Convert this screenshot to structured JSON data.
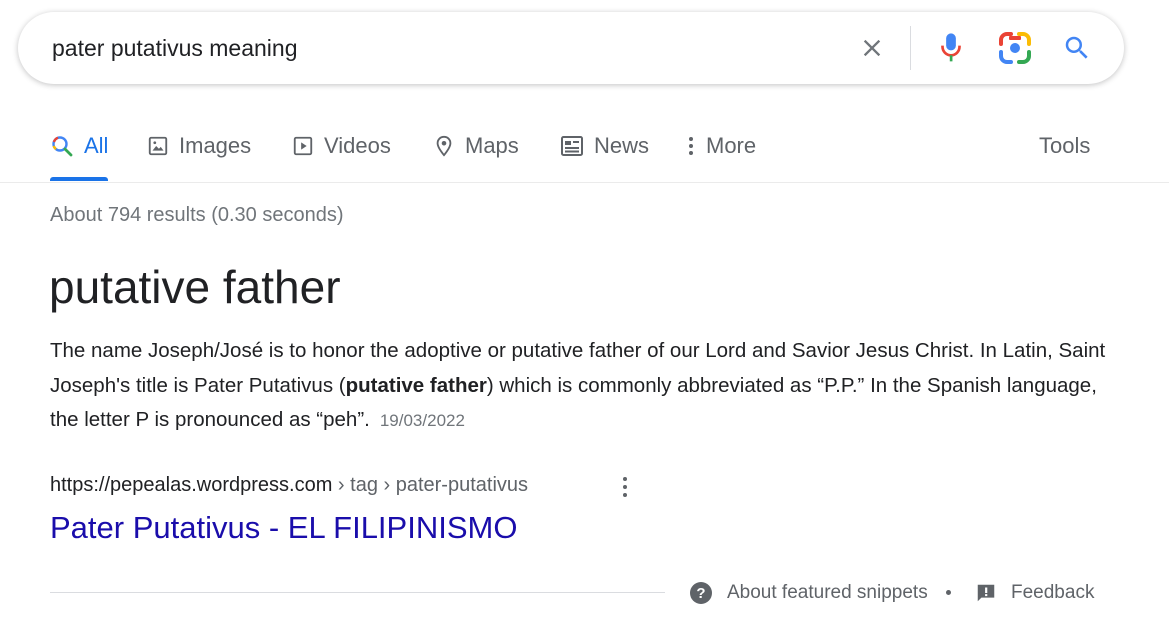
{
  "search": {
    "query": "pater putativus meaning"
  },
  "icons": {
    "clear": "close-icon",
    "mic": "microphone-icon",
    "lens": "camera-lens-icon",
    "search": "search-icon"
  },
  "tabs": [
    {
      "label": "All",
      "icon": "search-icon",
      "active": true
    },
    {
      "label": "Images",
      "icon": "image-icon"
    },
    {
      "label": "Videos",
      "icon": "play-icon"
    },
    {
      "label": "Maps",
      "icon": "map-pin-icon"
    },
    {
      "label": "News",
      "icon": "news-icon"
    },
    {
      "label": "More",
      "icon": "more-vert-icon"
    }
  ],
  "tools_label": "Tools",
  "result_stats": "About 794 results (0.30 seconds)",
  "featured_snippet": {
    "title": "putative father",
    "text_before": "The name Joseph/José is to honor the adoptive or putative father of our Lord and Savior Jesus Christ. In Latin, Saint Joseph's title is Pater Putativus (",
    "text_bold": "putative father",
    "text_after": ") which is commonly abbreviated as “P.P.” In the Spanish language, the letter P is pronounced as “peh”.",
    "date": "19/03/2022"
  },
  "source": {
    "domain": "https://pepealas.wordpress.com",
    "breadcrumb": " › tag › pater-putativus",
    "link_title": "Pater Putativus - EL FILIPINISMO"
  },
  "footer": {
    "about_label": "About featured snippets",
    "separator": "•",
    "feedback_label": "Feedback"
  },
  "colors": {
    "accent": "#1a73e8",
    "link": "#1a0dab",
    "muted": "#70757a"
  }
}
